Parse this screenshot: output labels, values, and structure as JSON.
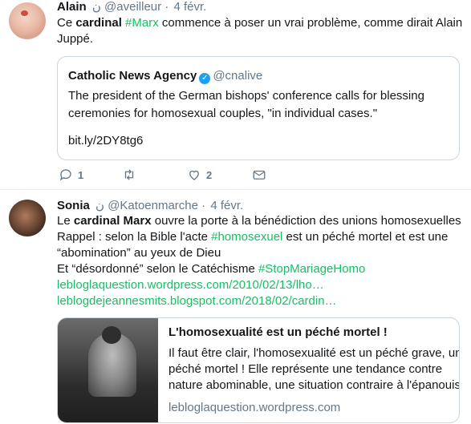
{
  "tweets": [
    {
      "name": "Alain",
      "handle": "ن @aveilleur",
      "dot": "·",
      "date": "4 févr.",
      "body": {
        "p1": "Ce ",
        "b1": "cardinal",
        "sp": " ",
        "hashtag": "#Marx",
        "p2": " commence à poser un vrai problème, comme dirait Alain",
        "line2": "Juppé."
      },
      "quote": {
        "name": "Catholic News Agency",
        "verified_symbol": "✓",
        "handle": "@cnalive",
        "text": "The president of the German bishops' conference calls for blessing ceremonies for homosexual couples, \"in individual cases.\"",
        "link": "bit.ly/2DY8tg6"
      },
      "actions": {
        "replies": "1",
        "retweets": "",
        "likes": "2"
      }
    },
    {
      "name": "Sonia",
      "handle": "ن @Katoenmarche",
      "dot": "·",
      "date": "4 févr.",
      "body": {
        "l1a": "Le ",
        "l1b": "cardinal Marx",
        "l1c": " ouvre la porte à la bénédiction des unions homosexuelles",
        "l2a": "Rappel : selon la Bible l'acte ",
        "l2b": "#homosexuel",
        "l2c": " est un péché mortel et est une",
        "l3": "“abomination” au yeux de Dieu",
        "l4a": "Et “désordonné” selon le Catéchisme ",
        "l4b": "#StopMariageHomo",
        "l5": "lebloglaquestion.wordpress.com/2010/02/13/lho…",
        "l6": "leblogdejeannesmits.blogspot.com/2018/02/cardin…"
      },
      "card": {
        "title": "L'homosexualité est un péché mortel !",
        "desc1": "Il faut être clair, l'homosexualité est un péché grave, un",
        "desc2": "péché mortel ! Elle représente une tendance contre",
        "desc3": "nature abominable, une situation contraire à l'épanouis…",
        "domain": "lebloglaquestion.wordpress.com"
      }
    }
  ],
  "colors": {
    "hashtag": "#17bf63",
    "muted": "#657786",
    "border": "#ccd6dd",
    "verified": "#1da1f2"
  }
}
